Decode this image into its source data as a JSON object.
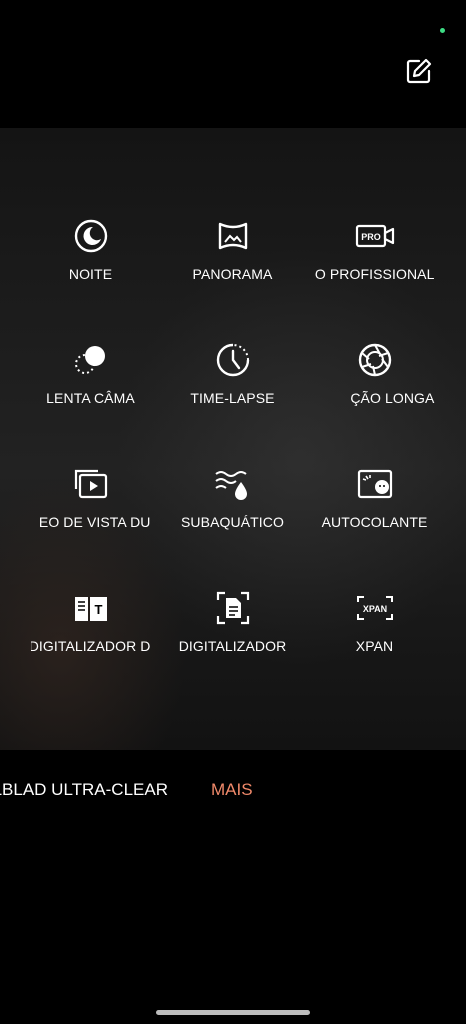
{
  "top": {
    "edit_icon": "edit-square-icon"
  },
  "modes": [
    {
      "label": "NOITE",
      "icon": "moon-icon"
    },
    {
      "label": "PANORAMA",
      "icon": "panorama-icon"
    },
    {
      "label": "O PROFISSIONAL",
      "icon": "pro-video-icon"
    },
    {
      "label": "LENTA CÂMA",
      "icon": "slow-motion-icon"
    },
    {
      "label": "TIME-LAPSE",
      "icon": "timelapse-icon"
    },
    {
      "label": "ÇÃO LONGA",
      "icon": "long-exposure-icon"
    },
    {
      "label": "EO DE VISTA DU",
      "icon": "dual-view-video-icon"
    },
    {
      "label": "SUBAQUÁTICO",
      "icon": "underwater-icon"
    },
    {
      "label": "AUTOCOLANTE",
      "icon": "sticker-icon"
    },
    {
      "label": "DIGITALIZADOR D",
      "icon": "text-scanner-icon"
    },
    {
      "label": "DIGITALIZADOR",
      "icon": "document-scanner-icon"
    },
    {
      "label": "XPAN",
      "icon": "xpan-icon"
    }
  ],
  "bottom": {
    "mode_left": "HASSELBLAD ULTRA-CLEAR",
    "more": "MAIS"
  },
  "colors": {
    "accent": "#f0896a",
    "status_dot": "#3ddc84"
  }
}
